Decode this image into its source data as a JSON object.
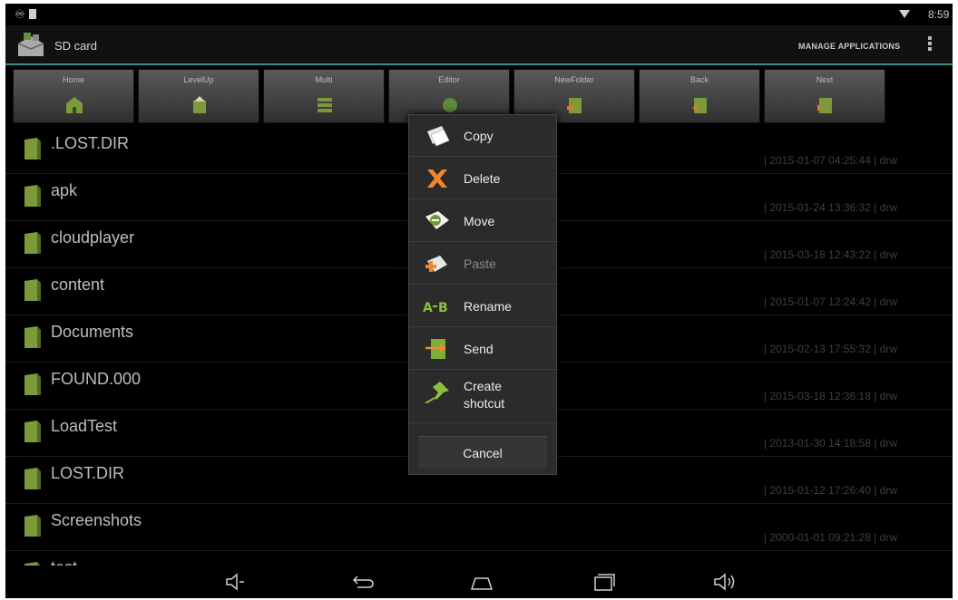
{
  "status_bar": {
    "time": "8:59"
  },
  "action_bar": {
    "title": "SD card",
    "manage_label": "MANAGE APPLICATIONS"
  },
  "toolbar": {
    "buttons": [
      {
        "label": "Home",
        "icon": "home-icon"
      },
      {
        "label": "LevelUp",
        "icon": "level-up-icon"
      },
      {
        "label": "Multi",
        "icon": "multi-select-icon"
      },
      {
        "label": "Editor",
        "icon": "editor-icon"
      },
      {
        "label": "NewFolder",
        "icon": "new-folder-icon"
      },
      {
        "label": "Back",
        "icon": "back-icon"
      },
      {
        "label": "Next",
        "icon": "next-icon"
      }
    ]
  },
  "files": [
    {
      "name": ".LOST.DIR",
      "meta": "| 2015-01-07 04:25:44 | drw"
    },
    {
      "name": "apk",
      "meta": "| 2015-01-24 13:36:32 | drw"
    },
    {
      "name": "cloudplayer",
      "meta": "| 2015-03-18 12:43:22 | drw"
    },
    {
      "name": "content",
      "meta": "| 2015-01-07 12:24:42 | drw"
    },
    {
      "name": "Documents",
      "meta": "| 2015-02-13 17:55:32 | drw"
    },
    {
      "name": "FOUND.000",
      "meta": "| 2015-03-18 12:36:18 | drw"
    },
    {
      "name": "LoadTest",
      "meta": "| 2013-01-30 14:18:58 | drw"
    },
    {
      "name": "LOST.DIR",
      "meta": "| 2015-01-12 17:26:40 | drw"
    },
    {
      "name": "Screenshots",
      "meta": "| 2000-01-01 09:21:28 | drw"
    },
    {
      "name": "test",
      "meta": ""
    }
  ],
  "context_menu": {
    "items": [
      {
        "label": "Copy",
        "icon": "copy-icon",
        "enabled": true
      },
      {
        "label": "Delete",
        "icon": "delete-icon",
        "enabled": true
      },
      {
        "label": "Move",
        "icon": "move-icon",
        "enabled": true
      },
      {
        "label": "Paste",
        "icon": "paste-icon",
        "enabled": false
      },
      {
        "label": "Rename",
        "icon": "rename-icon",
        "enabled": true
      },
      {
        "label": "Send",
        "icon": "send-icon",
        "enabled": true
      },
      {
        "label": "Create shotcut",
        "icon": "create-shortcut-icon",
        "enabled": true
      }
    ],
    "cancel_label": "Cancel"
  },
  "colors": {
    "accent": "#3c8b8b",
    "folder": "#7c9a3a",
    "delete": "#f0882a"
  }
}
